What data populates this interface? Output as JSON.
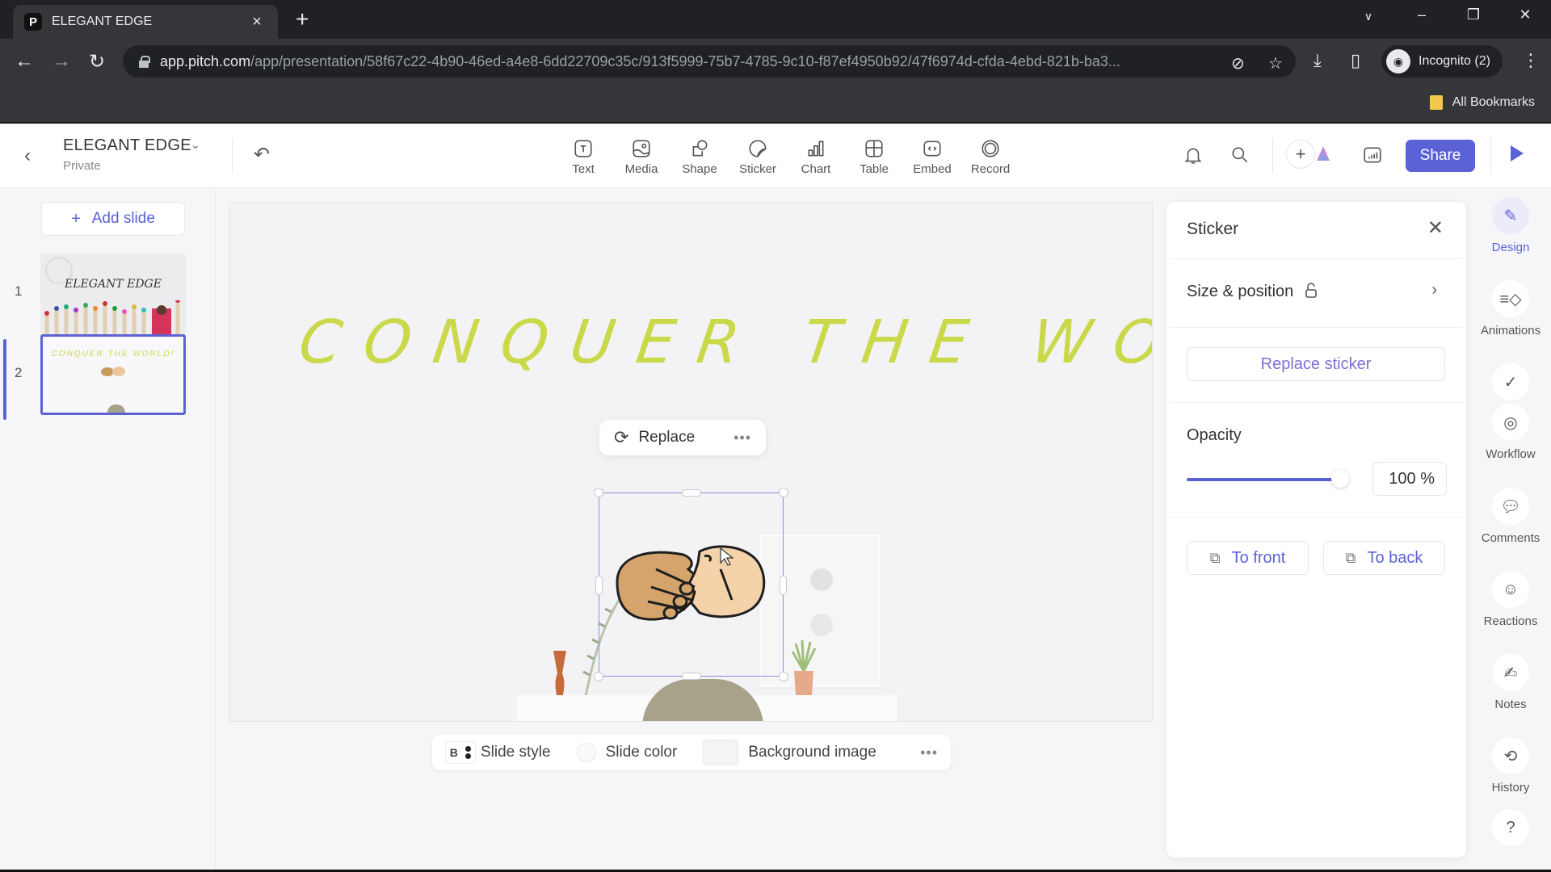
{
  "browser": {
    "tab_title": "ELEGANT EDGE",
    "favicon_letter": "P",
    "url_host": "app.pitch.com",
    "url_path": "/app/presentation/58f67c22-4b90-46ed-a4e8-6dd22709c35c/913f5999-75b7-4785-9c10-f87ef4950b92/47f6974d-cfda-4ebd-821b-ba3...",
    "incognito_label": "Incognito (2)",
    "bookmarks_label": "All Bookmarks"
  },
  "header": {
    "doc_title": "ELEGANT EDGE",
    "doc_visibility": "Private",
    "share_label": "Share"
  },
  "toolbar": {
    "tools": [
      {
        "label": "Text",
        "icon": "text-icon"
      },
      {
        "label": "Media",
        "icon": "media-icon"
      },
      {
        "label": "Shape",
        "icon": "shape-icon"
      },
      {
        "label": "Sticker",
        "icon": "sticker-icon"
      },
      {
        "label": "Chart",
        "icon": "chart-icon"
      },
      {
        "label": "Table",
        "icon": "table-icon"
      },
      {
        "label": "Embed",
        "icon": "embed-icon"
      },
      {
        "label": "Record",
        "icon": "record-icon"
      }
    ]
  },
  "sidebar": {
    "add_slide_label": "Add slide",
    "slides": [
      {
        "number": "1",
        "thumb_title": "ELEGANT EDGE",
        "active": false
      },
      {
        "number": "2",
        "thumb_title": "CONQUER THE WORLD!",
        "active": true
      }
    ]
  },
  "canvas": {
    "headline": "CONQUER THE WORLD!",
    "replace_label": "Replace",
    "more_label": "•••"
  },
  "bottom_bar": {
    "style_badge": "B",
    "slide_style_label": "Slide style",
    "slide_color_label": "Slide color",
    "background_image_label": "Background image",
    "more_label": "•••"
  },
  "panel": {
    "title": "Sticker",
    "size_position_label": "Size & position",
    "replace_sticker_label": "Replace sticker",
    "opacity_label": "Opacity",
    "opacity_value": "100 %",
    "opacity_percent": 100,
    "to_front_label": "To front",
    "to_back_label": "To back"
  },
  "rail": {
    "items": [
      {
        "label": "Design",
        "icon": "design-icon",
        "active": true
      },
      {
        "label": "Animations",
        "icon": "animations-icon",
        "active": false
      },
      {
        "label": "Workflow",
        "icon": "workflow-icon",
        "active": false
      },
      {
        "label": "Comments",
        "icon": "comments-icon",
        "active": false
      },
      {
        "label": "Reactions",
        "icon": "reactions-icon",
        "active": false
      },
      {
        "label": "Notes",
        "icon": "notes-icon",
        "active": false
      },
      {
        "label": "History",
        "icon": "history-icon",
        "active": false
      }
    ]
  },
  "colors": {
    "accent": "#5b62d6",
    "headline": "#c9d94a"
  }
}
